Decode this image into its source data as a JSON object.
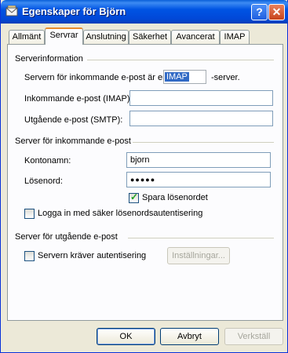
{
  "window": {
    "title": "Egenskaper för Björn",
    "help_label": "?",
    "close_label": "✕"
  },
  "tabs": [
    {
      "label": "Allmänt",
      "active": false
    },
    {
      "label": "Servrar",
      "active": true
    },
    {
      "label": "Anslutning",
      "active": false
    },
    {
      "label": "Säkerhet",
      "active": false
    },
    {
      "label": "Avancerat",
      "active": false
    },
    {
      "label": "IMAP",
      "active": false
    }
  ],
  "server_info": {
    "heading": "Serverinformation",
    "incoming_type_prefix": "Servern för inkommande e-post är en",
    "incoming_type_value": "IMAP",
    "incoming_type_suffix": "-server.",
    "incoming_label": "Inkommande e-post (IMAP):",
    "incoming_value": "",
    "outgoing_label": "Utgående e-post (SMTP):",
    "outgoing_value": ""
  },
  "incoming_server": {
    "heading": "Server för inkommande e-post",
    "account_label": "Kontonamn:",
    "account_value": "bjorn",
    "password_label": "Lösenord:",
    "password_value": "●●●●●",
    "save_password_label": "Spara lösenordet",
    "save_password_checked": true,
    "secure_login_label": "Logga in med säker lösenordsautentisering",
    "secure_login_checked": false
  },
  "outgoing_server": {
    "heading": "Server för utgående e-post",
    "requires_auth_label": "Servern kräver autentisering",
    "requires_auth_checked": false,
    "settings_button": "Inställningar..."
  },
  "footer": {
    "ok": "OK",
    "cancel": "Avbryt",
    "apply": "Verkställ"
  }
}
